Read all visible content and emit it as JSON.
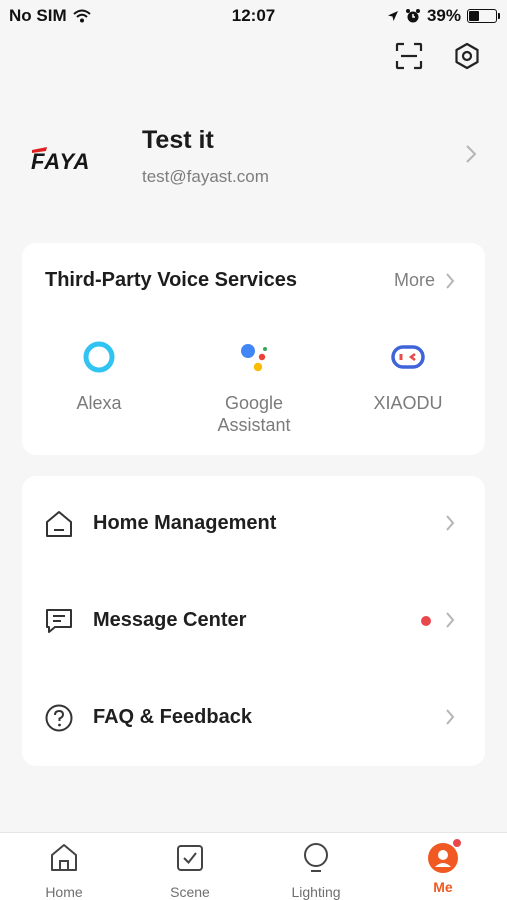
{
  "status_bar": {
    "carrier": "No SIM",
    "time": "12:07",
    "battery_percent": "39%",
    "battery_level": 0.39,
    "icons": [
      "wifi-icon",
      "location-arrow-icon",
      "alarm-icon",
      "battery-icon"
    ]
  },
  "top_actions": {
    "scan_icon": "scan-icon",
    "settings_icon": "settings-hexagon-icon"
  },
  "profile": {
    "logo_text": "FAYA",
    "name": "Test it",
    "email": "test@fayast.com"
  },
  "voice_services": {
    "title": "Third-Party Voice Services",
    "more_label": "More",
    "items": [
      {
        "label": "Alexa",
        "icon": "alexa-icon"
      },
      {
        "label": "Google\nAssistant",
        "icon": "google-assistant-icon"
      },
      {
        "label": "XIAODU",
        "icon": "xiaodu-icon"
      }
    ]
  },
  "menu": {
    "items": [
      {
        "label": "Home Management",
        "icon": "home-outline-icon"
      },
      {
        "label": "Message Center",
        "icon": "message-icon",
        "has_badge": true
      },
      {
        "label": "FAQ & Feedback",
        "icon": "question-circle-icon"
      }
    ]
  },
  "tabs": [
    {
      "label": "Home",
      "icon": "home-tab-icon",
      "active": false
    },
    {
      "label": "Scene",
      "icon": "scene-check-icon",
      "active": false
    },
    {
      "label": "Lighting",
      "icon": "bulb-icon",
      "active": false
    },
    {
      "label": "Me",
      "icon": "me-avatar-icon",
      "active": true
    }
  ],
  "colors": {
    "accent": "#f05a22",
    "badge": "#e8474b",
    "background": "#f6f6f6",
    "alexa": "#31c4f3",
    "xiaodu": "#3f63d8"
  }
}
